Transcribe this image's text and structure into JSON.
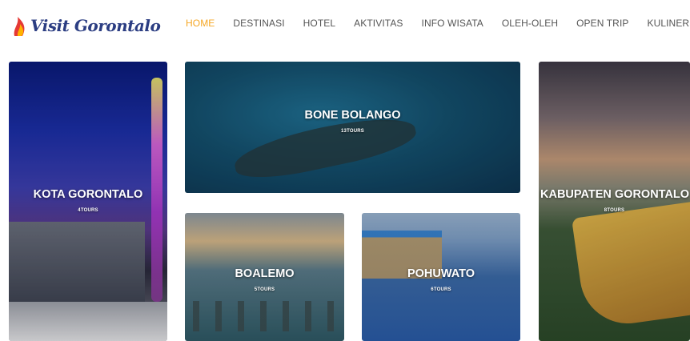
{
  "brand": {
    "name": "Visit Gorontalo"
  },
  "nav": {
    "items": [
      "HOME",
      "DESTINASI",
      "HOTEL",
      "AKTIVITAS",
      "INFO WISATA",
      "OLEH-OLEH",
      "OPEN TRIP",
      "KULINER"
    ],
    "active": "HOME"
  },
  "colors": {
    "accent": "#f5a623",
    "brand": "#2b3d82"
  },
  "destinations": {
    "kota": {
      "title": "KOTA GORONTALO",
      "tours": "4TOURS"
    },
    "bone": {
      "title": "BONE BOLANGO",
      "tours": "13TOURS"
    },
    "boalemo": {
      "title": "BOALEMO",
      "tours": "5TOURS"
    },
    "pohuwato": {
      "title": "POHUWATO",
      "tours": "6TOURS"
    },
    "kabupaten": {
      "title": "KABUPATEN GORONTALO",
      "tours": "8TOURS"
    }
  }
}
